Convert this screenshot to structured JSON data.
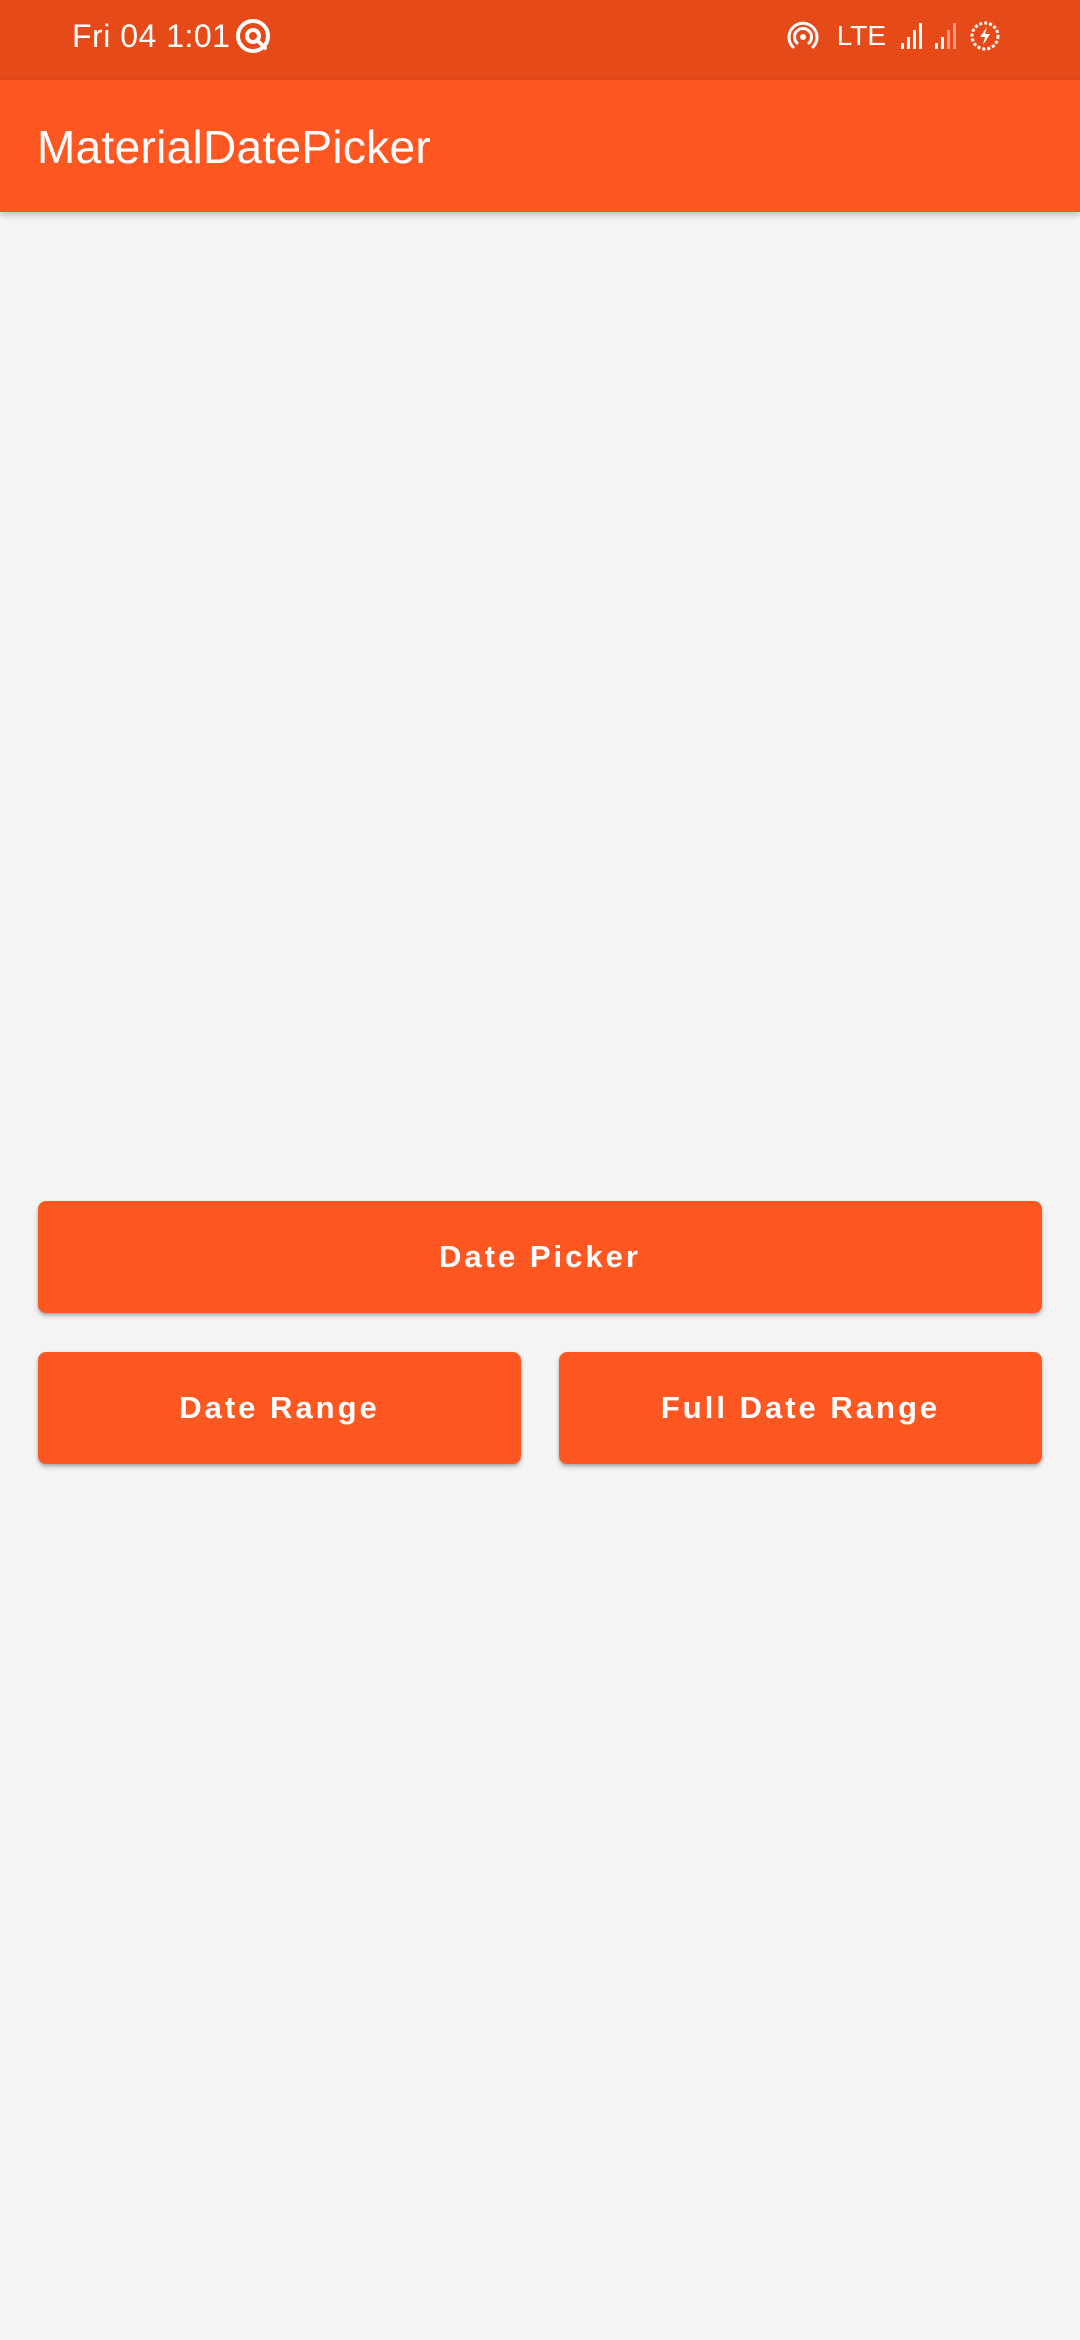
{
  "status_bar": {
    "time": "Fri 04 1:01",
    "network": "LTE",
    "icons": [
      "sync-icon",
      "hotspot-icon",
      "signal-icon",
      "signal-weak-icon",
      "battery-saver-icon"
    ]
  },
  "app_bar": {
    "title": "MaterialDatePicker"
  },
  "buttons": {
    "date_picker": "Date Picker",
    "date_range": "Date Range",
    "full_date_range": "Full Date Range"
  },
  "colors": {
    "status_bar": "#e64a19",
    "primary": "#ff5722",
    "background": "#f4f4f4",
    "on_primary": "#ffffff"
  }
}
